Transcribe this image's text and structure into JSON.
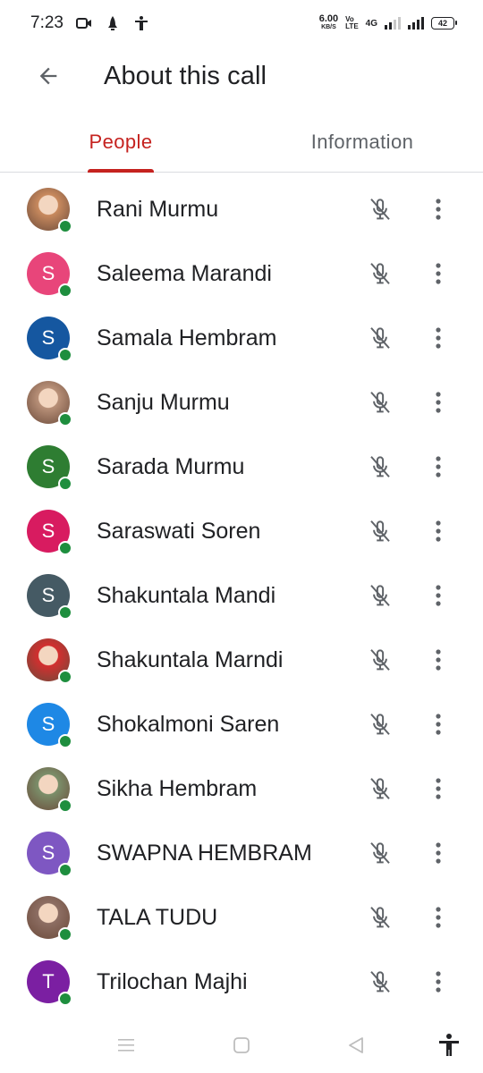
{
  "status_bar": {
    "time": "7:23",
    "speed_value": "6.00",
    "speed_unit": "KB/S",
    "volte_top": "Vo",
    "volte_bottom": "LTE",
    "network": "4G",
    "battery": "42",
    "icons": [
      "video-call-icon",
      "notification-icon",
      "accessibility-icon"
    ]
  },
  "header": {
    "title": "About this call"
  },
  "tabs": [
    {
      "label": "People",
      "active": true
    },
    {
      "label": "Information",
      "active": false
    }
  ],
  "people": [
    {
      "name": "Rani Murmu",
      "initial": "",
      "avatar_type": "photo",
      "avatar_color": "#c98a5e",
      "muted": true,
      "online": true
    },
    {
      "name": "Saleema Marandi",
      "initial": "S",
      "avatar_type": "letter",
      "avatar_color": "#e8457a",
      "muted": true,
      "online": true
    },
    {
      "name": "Samala Hembram",
      "initial": "S",
      "avatar_type": "letter",
      "avatar_color": "#1557a0",
      "muted": true,
      "online": true
    },
    {
      "name": "Sanju Murmu",
      "initial": "",
      "avatar_type": "photo",
      "avatar_color": "#b89078",
      "muted": true,
      "online": true
    },
    {
      "name": "Sarada Murmu",
      "initial": "S",
      "avatar_type": "letter",
      "avatar_color": "#2e7d32",
      "muted": true,
      "online": true
    },
    {
      "name": "Saraswati Soren",
      "initial": "S",
      "avatar_type": "letter",
      "avatar_color": "#d81b60",
      "muted": true,
      "online": true
    },
    {
      "name": "Shakuntala Mandi",
      "initial": "S",
      "avatar_type": "letter",
      "avatar_color": "#455a64",
      "muted": true,
      "online": true
    },
    {
      "name": "Shakuntala Marndi",
      "initial": "",
      "avatar_type": "photo",
      "avatar_color": "#d32f2f",
      "muted": true,
      "online": true
    },
    {
      "name": "Shokalmoni Saren",
      "initial": "S",
      "avatar_type": "letter",
      "avatar_color": "#1e88e5",
      "muted": true,
      "online": true
    },
    {
      "name": "Sikha Hembram",
      "initial": "",
      "avatar_type": "photo",
      "avatar_color": "#7b8f6a",
      "muted": true,
      "online": true
    },
    {
      "name": "SWAPNA HEMBRAM",
      "initial": "S",
      "avatar_type": "letter",
      "avatar_color": "#7e57c2",
      "muted": true,
      "online": true
    },
    {
      "name": "TALA TUDU",
      "initial": "",
      "avatar_type": "photo",
      "avatar_color": "#8d6e63",
      "muted": true,
      "online": true
    },
    {
      "name": "Trilochan Majhi",
      "initial": "T",
      "avatar_type": "letter",
      "avatar_color": "#7b1fa2",
      "muted": true,
      "online": true
    }
  ],
  "colors": {
    "accent": "#c5221f",
    "online": "#1e8e3e",
    "icon": "#5f6368"
  },
  "nav_bar": {
    "icons": [
      "menu-icon",
      "home-icon",
      "back-triangle-icon",
      "accessibility-icon"
    ]
  }
}
